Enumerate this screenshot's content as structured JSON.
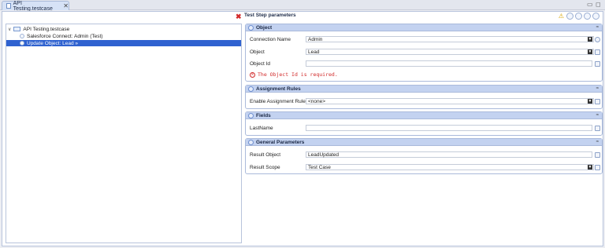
{
  "editor_tab": {
    "label": "API Testing.testcase",
    "close": "✕"
  },
  "window_controls": {
    "minimize": "▭",
    "maximize": "◻"
  },
  "tree": {
    "root": {
      "label": "API Testing.testcase",
      "twisty": "∨"
    },
    "children": [
      {
        "label": "Salesforce Connect: Admin (Test)"
      },
      {
        "label": "Update Object: Lead »"
      }
    ]
  },
  "params": {
    "title": "Test Step parameters",
    "toolbar_icons": [
      "warning-icon",
      "tag-icon",
      "history-icon",
      "link-icon",
      "help-icon"
    ]
  },
  "sections": {
    "object": {
      "title": "Object",
      "collapse": "≈",
      "connection_name": {
        "label": "Connection Name",
        "value": "Admin"
      },
      "object": {
        "label": "Object",
        "value": "Lead"
      },
      "object_id": {
        "label": "Object Id",
        "value": ""
      },
      "error": {
        "icon": "×",
        "text": "The Object Id is required."
      }
    },
    "assignment_rules": {
      "title": "Assignment Rules",
      "collapse": "≈",
      "enable_assignment_rule": {
        "label": "Enable Assignment Rule",
        "value": "<none>"
      }
    },
    "fields": {
      "title": "Fields",
      "collapse": "≈",
      "last_name": {
        "label": "LastName",
        "value": ""
      }
    },
    "general_parameters": {
      "title": "General Parameters",
      "collapse": "≈",
      "result_object": {
        "label": "Result Object",
        "value": "LeadUpdated"
      },
      "result_scope": {
        "label": "Result Scope",
        "value": "Test Case"
      }
    }
  },
  "dropdown_glyph": "▼",
  "warning_glyph": "⚠",
  "close_glyph": "✖"
}
